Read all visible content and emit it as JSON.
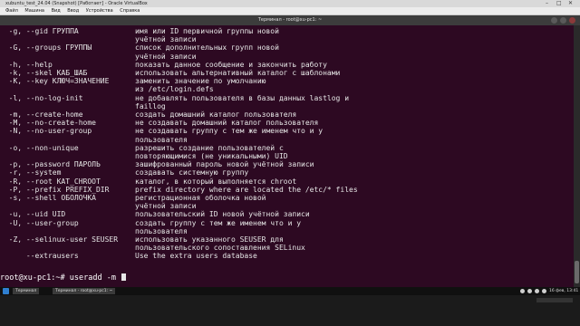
{
  "host": {
    "window_title": "xubuntu_test_24.04 (Snapshot) [Работает] - Oracle VirtualBox",
    "menu": [
      "Файл",
      "Машина",
      "Вид",
      "Ввод",
      "Устройства",
      "Справка"
    ],
    "controls": [
      "–",
      "□",
      "✕"
    ]
  },
  "guest_window": {
    "title": "Терминал - root@xu-pc1: ~"
  },
  "terminal": {
    "lines": [
      {
        "opt": "  -g, --gid ГРУППА",
        "desc": "имя или ID первичной группы новой"
      },
      {
        "opt": "",
        "desc": "учётной записи"
      },
      {
        "opt": "  -G, --groups ГРУППЫ",
        "desc": "список дополнительных групп новой"
      },
      {
        "opt": "",
        "desc": "учётной записи"
      },
      {
        "opt": "  -h, --help",
        "desc": "показать данное сообщение и закончить работу"
      },
      {
        "opt": "  -k, --skel КАБ_ШАБ",
        "desc": "использовать альтернативный каталог с шаблонами"
      },
      {
        "opt": "  -K, --key КЛЮЧ=ЗНАЧЕНИЕ",
        "desc": "заменить значение по умолчанию"
      },
      {
        "opt": "",
        "desc": "из /etc/login.defs"
      },
      {
        "opt": "  -l, --no-log-init",
        "desc": "не добавлять пользователя в базы данных lastlog и"
      },
      {
        "opt": "",
        "desc": "faillog"
      },
      {
        "opt": "  -m, --create-home",
        "desc": "создать домашний каталог пользователя"
      },
      {
        "opt": "  -M, --no-create-home",
        "desc": "не создавать домашний каталог пользователя"
      },
      {
        "opt": "  -N, --no-user-group",
        "desc": "не создавать группу с тем же именем что и у"
      },
      {
        "opt": "",
        "desc": "пользователя"
      },
      {
        "opt": "  -o, --non-unique",
        "desc": "разрешить создание пользователей с"
      },
      {
        "opt": "",
        "desc": "повторяющимися (не уникальными) UID"
      },
      {
        "opt": "  -p, --password ПАРОЛЬ",
        "desc": "зашифрованный пароль новой учётной записи"
      },
      {
        "opt": "  -r, --system",
        "desc": "создавать системную группу"
      },
      {
        "opt": "  -R, --root КАТ_CHROOT",
        "desc": "каталог, в который выполняется chroot"
      },
      {
        "opt": "  -P, --prefix PREFIX_DIR",
        "desc": "prefix directory where are located the /etc/* files"
      },
      {
        "opt": "  -s, --shell ОБОЛОЧКА",
        "desc": "регистрационная оболочка новой"
      },
      {
        "opt": "",
        "desc": "учётной записи"
      },
      {
        "opt": "  -u, --uid UID",
        "desc": "пользовательский ID новой учётной записи"
      },
      {
        "opt": "  -U, --user-group",
        "desc": "создать группу с тем же именем что и у"
      },
      {
        "opt": "",
        "desc": "пользователя"
      },
      {
        "opt": "  -Z, --selinux-user SEUSER",
        "desc": "использовать указанного SEUSER для"
      },
      {
        "opt": "",
        "desc": "пользовательского сопоставления SELinux"
      },
      {
        "opt": "      --extrausers",
        "desc": "Use the extra users database"
      }
    ],
    "prompt": "root@xu-pc1:~# ",
    "command": "useradd -m "
  },
  "taskbar": {
    "task_1": "Терминал",
    "task_2": "Терминал - root@xu-pc1: ~",
    "clock": "16 фев, 13:41"
  }
}
